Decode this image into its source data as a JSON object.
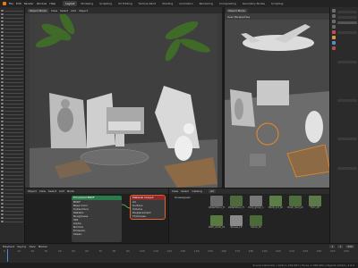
{
  "topbar": {
    "menus": [
      "File",
      "Edit",
      "Render",
      "Window",
      "Help"
    ],
    "workspaces": [
      "Layout",
      "Modeling",
      "Sculpting",
      "UV Editing",
      "Texture Paint",
      "Shading",
      "Animation",
      "Rendering",
      "Compositing",
      "Geometry Nodes",
      "Scripting"
    ],
    "active_workspace": "Layout"
  },
  "viewport_left": {
    "mode": "Object Mode",
    "menus": [
      "View",
      "Select",
      "Add",
      "Object"
    ]
  },
  "viewport_right": {
    "mode": "Object Mode",
    "label": "User Perspective"
  },
  "node_editor": {
    "menus": [
      "Object",
      "View",
      "Select",
      "Add",
      "Node"
    ],
    "node_main": {
      "title": "Principled BSDF",
      "rows": [
        "BSDF",
        "Base Color",
        "Subsurface",
        "Metallic",
        "Roughness",
        "IOR",
        "Alpha",
        "Normal",
        "Emission",
        "Sheen"
      ]
    },
    "node_output": {
      "title": "Material Output",
      "rows": [
        "All",
        "Surface",
        "Volume",
        "Displacement",
        "Thickness"
      ]
    }
  },
  "asset_browser": {
    "menus": [
      "View",
      "Select",
      "Catalog"
    ],
    "library": "All",
    "catalog": "Unassigned",
    "items": [
      {
        "label": "WaterStone_Tree_LP",
        "color": "#6a6a6a"
      },
      {
        "label": "WaterStone_Tree_LP",
        "color": "#4e6a3c"
      },
      {
        "label": "Rock_group_1",
        "color": "#777777"
      },
      {
        "label": "Plant_pot_LP",
        "color": "#5c7d45"
      },
      {
        "label": "Bush_med_LP",
        "color": "#4d6e3a"
      },
      {
        "label": "Fern_LP",
        "color": "#5b7a48"
      },
      {
        "label": "Palm_small_LP",
        "color": "#587a40"
      },
      {
        "label": "Stones_LP",
        "color": "#8a8a8a"
      },
      {
        "label": "Shrub_LP",
        "color": "#4a6a38"
      }
    ]
  },
  "timeline": {
    "menus": [
      "Playback",
      "Keying",
      "View",
      "Marker"
    ],
    "ticks": [
      "0",
      "10",
      "20",
      "30",
      "40",
      "50",
      "60",
      "70",
      "80",
      "90",
      "100",
      "110",
      "120",
      "130",
      "140",
      "150",
      "160",
      "170",
      "180",
      "190",
      "200",
      "210",
      "220",
      "230",
      "240",
      "250"
    ],
    "current_frame": "1",
    "start": "1",
    "end": "250"
  },
  "statusbar": {
    "version": "Scene Collection | Verts 1,234,567 | Faces 1,198,000 | Objects 0/214 | 4.0.2"
  }
}
